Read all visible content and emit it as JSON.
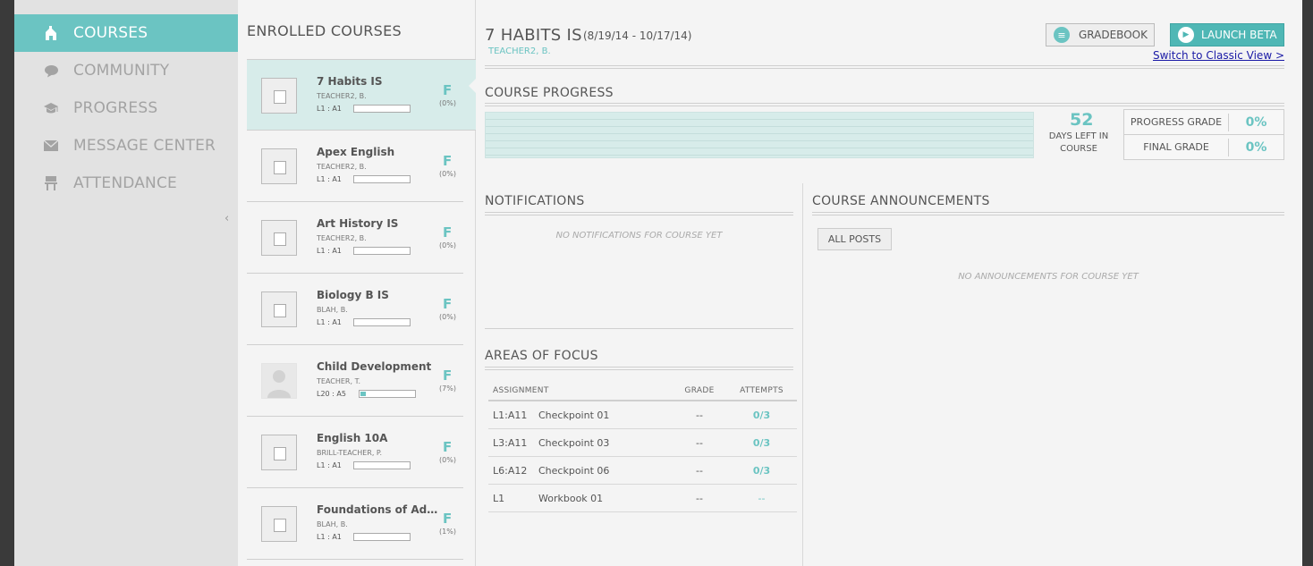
{
  "sidebar": {
    "items": [
      {
        "label": "COURSES",
        "icon": "courses-icon"
      },
      {
        "label": "COMMUNITY",
        "icon": "speech-bubble-icon"
      },
      {
        "label": "PROGRESS",
        "icon": "graduation-cap-icon"
      },
      {
        "label": "MESSAGE CENTER",
        "icon": "envelope-icon"
      },
      {
        "label": "ATTENDANCE",
        "icon": "desk-chair-icon"
      }
    ],
    "collapse_glyph": "‹"
  },
  "courses": {
    "title": "ENROLLED COURSES",
    "list": [
      {
        "name": "7 Habits IS",
        "teacher": "TEACHER2, B.",
        "level": "L1 : A1",
        "grade": "F",
        "pct": "(0%)",
        "progress": 0
      },
      {
        "name": "Apex English",
        "teacher": "TEACHER2, B.",
        "level": "L1 : A1",
        "grade": "F",
        "pct": "(0%)",
        "progress": 0
      },
      {
        "name": "Art History IS",
        "teacher": "TEACHER2, B.",
        "level": "L1 : A1",
        "grade": "F",
        "pct": "(0%)",
        "progress": 0
      },
      {
        "name": "Biology B IS",
        "teacher": "BLAH, B.",
        "level": "L1 : A1",
        "grade": "F",
        "pct": "(0%)",
        "progress": 0
      },
      {
        "name": "Child Development",
        "teacher": "TEACHER, T.",
        "level": "L20 : A5",
        "grade": "F",
        "pct": "(7%)",
        "progress": 0.1
      },
      {
        "name": "English 10A",
        "teacher": "BRILL-TEACHER, P.",
        "level": "L1 : A1",
        "grade": "F",
        "pct": "(0%)",
        "progress": 0
      },
      {
        "name": "Foundations of Adv…",
        "teacher": "BLAH, B.",
        "level": "L1 : A1",
        "grade": "F",
        "pct": "(1%)",
        "progress": 0
      }
    ]
  },
  "main": {
    "title": "7 HABITS IS",
    "dates": "(8/19/14 - 10/17/14)",
    "teacher": "TEACHER2, B.",
    "gradebook_label": "GRADEBOOK",
    "launch_beta_label": "LAUNCH BETA",
    "classic_link": "Switch to Classic View >",
    "course_progress_title": "COURSE PROGRESS",
    "days_left": "52",
    "days_left_label": "DAYS LEFT IN COURSE",
    "progress_grade_label": "PROGRESS GRADE",
    "progress_grade_value": "0%",
    "final_grade_label": "FINAL GRADE",
    "final_grade_value": "0%",
    "notifications_title": "NOTIFICATIONS",
    "notifications_empty": "NO NOTIFICATIONS FOR COURSE YET",
    "announcements_title": "COURSE ANNOUNCEMENTS",
    "all_posts_label": "ALL POSTS",
    "announcements_empty": "NO ANNOUNCEMENTS FOR COURSE YET",
    "focus_title": "AREAS OF FOCUS",
    "focus_headers": {
      "assignment": "ASSIGNMENT",
      "grade": "GRADE",
      "attempts": "ATTEMPTS"
    },
    "focus_rows": [
      {
        "code": "L1:A11",
        "name": "Checkpoint 01",
        "grade": "--",
        "attempts": "0/3"
      },
      {
        "code": "L3:A11",
        "name": "Checkpoint 03",
        "grade": "--",
        "attempts": "0/3"
      },
      {
        "code": "L6:A12",
        "name": "Checkpoint 06",
        "grade": "--",
        "attempts": "0/3"
      },
      {
        "code": "L1",
        "name": "Workbook 01",
        "grade": "--",
        "attempts": "--"
      }
    ]
  },
  "colors": {
    "accent": "#6bc4c2",
    "accent_dark": "#4fb7b5",
    "sidebar_bg": "#e2e2e2",
    "page_bg": "#f4f4f4"
  }
}
